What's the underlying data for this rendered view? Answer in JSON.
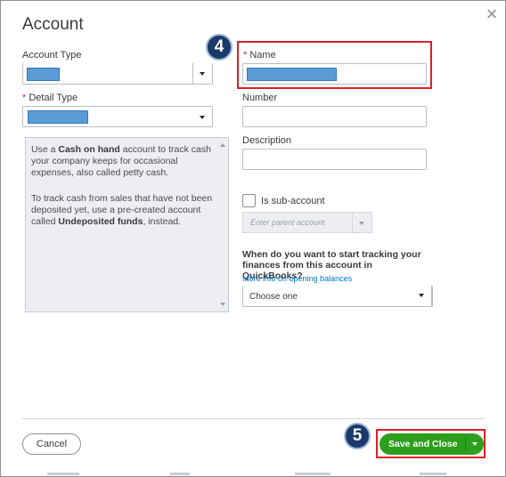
{
  "dialog": {
    "title": "Account",
    "close_label": "×"
  },
  "account_type": {
    "label": "Account Type",
    "value": ""
  },
  "detail_type": {
    "required_mark": "*",
    "label": "Detail Type",
    "value": ""
  },
  "info": {
    "p1_a": "Use a ",
    "p1_bold": "Cash on hand",
    "p1_b": " account to track cash your company keeps for occasional expenses, also called petty cash.",
    "p2_a": "To track cash from sales that have not been deposited yet, use a pre-created account called ",
    "p2_bold": "Undeposited funds",
    "p2_b": ", instead."
  },
  "name": {
    "required_mark": "*",
    "label": "Name",
    "value": ""
  },
  "number": {
    "label": "Number",
    "value": ""
  },
  "description": {
    "label": "Description",
    "value": ""
  },
  "sub_account": {
    "label": "Is sub-account",
    "checked": false,
    "parent_placeholder": "Enter parent account"
  },
  "tracking": {
    "question": "When do you want to start tracking your finances from this account in QuickBooks?",
    "link": "More info on opening balances",
    "select_value": "Choose one"
  },
  "footer": {
    "cancel_label": "Cancel",
    "save_label": "Save and Close"
  },
  "callouts": {
    "step4": "4",
    "step5": "5"
  },
  "colors": {
    "accent_green": "#2ca01c",
    "highlight_blue": "#5b9bd5",
    "callout_red": "#d92128",
    "badge_navy": "#1a3a6b",
    "required_red": "#d52b1e",
    "link_blue": "#0077c5"
  },
  "icons": {
    "close": "close-icon",
    "dropdown": "chevron-down-icon"
  }
}
